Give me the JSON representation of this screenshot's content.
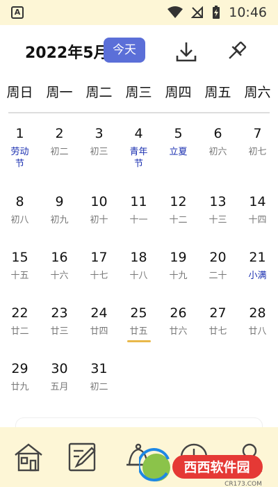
{
  "status_bar": {
    "time": "10:46",
    "app_icon_letter": "A"
  },
  "header": {
    "month_title": "2022年5月",
    "today_label": "今天"
  },
  "weekdays": [
    "周日",
    "周一",
    "周二",
    "周三",
    "周四",
    "周五",
    "周六"
  ],
  "days": [
    {
      "num": "1",
      "sub": "劳动\n节",
      "holiday": true
    },
    {
      "num": "2",
      "sub": "初二"
    },
    {
      "num": "3",
      "sub": "初三"
    },
    {
      "num": "4",
      "sub": "青年\n节",
      "holiday": true
    },
    {
      "num": "5",
      "sub": "立夏",
      "holiday": true
    },
    {
      "num": "6",
      "sub": "初六"
    },
    {
      "num": "7",
      "sub": "初七"
    },
    {
      "num": "8",
      "sub": "初八"
    },
    {
      "num": "9",
      "sub": "初九"
    },
    {
      "num": "10",
      "sub": "初十"
    },
    {
      "num": "11",
      "sub": "十一"
    },
    {
      "num": "12",
      "sub": "十二"
    },
    {
      "num": "13",
      "sub": "十三"
    },
    {
      "num": "14",
      "sub": "十四"
    },
    {
      "num": "15",
      "sub": "十五"
    },
    {
      "num": "16",
      "sub": "十六"
    },
    {
      "num": "17",
      "sub": "十七"
    },
    {
      "num": "18",
      "sub": "十八"
    },
    {
      "num": "19",
      "sub": "十九"
    },
    {
      "num": "20",
      "sub": "二十"
    },
    {
      "num": "21",
      "sub": "小满",
      "holiday": true
    },
    {
      "num": "22",
      "sub": "廿二"
    },
    {
      "num": "23",
      "sub": "廿三"
    },
    {
      "num": "24",
      "sub": "廿四"
    },
    {
      "num": "25",
      "sub": "廿五",
      "today": true
    },
    {
      "num": "26",
      "sub": "廿六"
    },
    {
      "num": "27",
      "sub": "廿七"
    },
    {
      "num": "28",
      "sub": "廿八"
    },
    {
      "num": "29",
      "sub": "廿九"
    },
    {
      "num": "30",
      "sub": "五月"
    },
    {
      "num": "31",
      "sub": "初二"
    }
  ],
  "nav": [
    {
      "icon": "house-icon"
    },
    {
      "icon": "note-edit-icon"
    },
    {
      "icon": "bell-icon"
    },
    {
      "icon": "clock-icon"
    },
    {
      "icon": "person-icon"
    }
  ],
  "watermark": {
    "brand": "西西软件园",
    "url": "CR173.COM"
  },
  "colors": {
    "accent": "#5b6fd8",
    "holiday": "#1a2fb0",
    "today_underline": "#e9b84a",
    "bar_background": "#fdf6d6"
  }
}
